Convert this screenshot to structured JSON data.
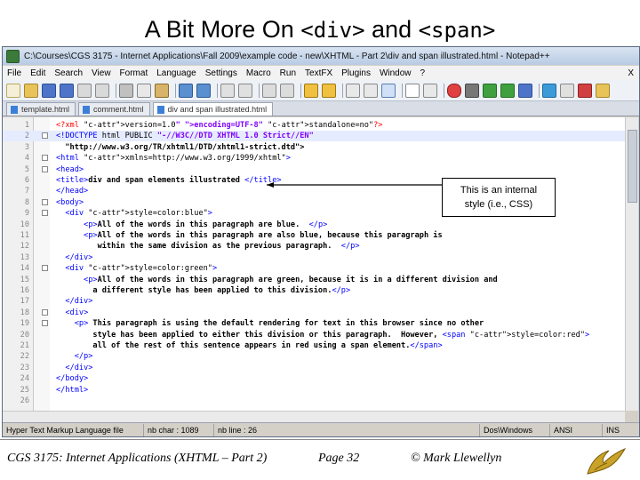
{
  "slide": {
    "title_part1": "A Bit More On ",
    "title_code1": "<div>",
    "title_part2": " and ",
    "title_code2": "<span>"
  },
  "window": {
    "title": "C:\\Courses\\CGS 3175 - Internet Applications\\Fall 2009\\example code - new\\XHTML - Part 2\\div and span illustrated.html - Notepad++"
  },
  "menu": [
    "File",
    "Edit",
    "Search",
    "View",
    "Format",
    "Language",
    "Settings",
    "Macro",
    "Run",
    "TextFX",
    "Plugins",
    "Window",
    "?"
  ],
  "menu_close": "X",
  "tabs": [
    {
      "label": "template.html",
      "active": false
    },
    {
      "label": "comment.html",
      "active": false
    },
    {
      "label": "div and span illustrated.html",
      "active": true
    }
  ],
  "code_lines": [
    {
      "n": "1",
      "text": "<?xml version=\"1.0\" encoding=\"UTF-8\" standalone=\"no\"?>"
    },
    {
      "n": "2",
      "text": "<!DOCTYPE html PUBLIC \"-//W3C//DTD XHTML 1.0 Strict//EN\""
    },
    {
      "n": "3",
      "text": "  \"http://www.w3.org/TR/xhtml1/DTD/xhtml1-strict.dtd\">"
    },
    {
      "n": "4",
      "text": "<html xmlns=\"http://www.w3.org/1999/xhtml\">"
    },
    {
      "n": "5",
      "text": "<head>"
    },
    {
      "n": "6",
      "text": "<title>div and span elements illustrated </title>"
    },
    {
      "n": "7",
      "text": "</head>"
    },
    {
      "n": "8",
      "text": "<body>"
    },
    {
      "n": "9",
      "text": "  <div style=\"color:blue\">"
    },
    {
      "n": "10",
      "text": "      <p>All of the words in this paragraph are blue.  </p>"
    },
    {
      "n": "11",
      "text": "      <p>All of the words in this paragraph are also blue, because this paragraph is"
    },
    {
      "n": "12",
      "text": "         within the same division as the previous paragraph.  </p>"
    },
    {
      "n": "13",
      "text": "  </div>"
    },
    {
      "n": "14",
      "text": "  <div style=\"color:green\">"
    },
    {
      "n": "15",
      "text": "      <p>All of the words in this paragraph are green, because it is in a different division and"
    },
    {
      "n": "16",
      "text": "        a different style has been applied to this division.</p>"
    },
    {
      "n": "17",
      "text": "  </div>"
    },
    {
      "n": "18",
      "text": "  <div>"
    },
    {
      "n": "19",
      "text": "    <p> This paragraph is using the default rendering for text in this browser since no other"
    },
    {
      "n": "20",
      "text": "        style has been applied to either this division or this paragraph.  However, <span style=\"color:red\">"
    },
    {
      "n": "21",
      "text": "        all of the rest of this sentence appears in red using a span element.</span>"
    },
    {
      "n": "22",
      "text": "    </p>"
    },
    {
      "n": "23",
      "text": "  </div>"
    },
    {
      "n": "24",
      "text": "</body>"
    },
    {
      "n": "25",
      "text": "</html>"
    },
    {
      "n": "26",
      "text": ""
    }
  ],
  "callout": {
    "line1": "This is an internal",
    "line2": "style (i.e., CSS)"
  },
  "status": {
    "lang": "Hyper Text Markup Language file",
    "chars": "nb char : 1089",
    "lines": "nb line : 26",
    "eol": "Dos\\Windows",
    "encoding": "ANSI",
    "mode": "INS"
  },
  "footer": {
    "course": "CGS 3175: Internet Applications (XHTML – Part 2)",
    "page": "Page 32",
    "author": "© Mark Llewellyn"
  },
  "colors": {
    "tag": "#0000ff",
    "attr": "#ff0000",
    "value": "#8000ff",
    "text": "#000000"
  }
}
